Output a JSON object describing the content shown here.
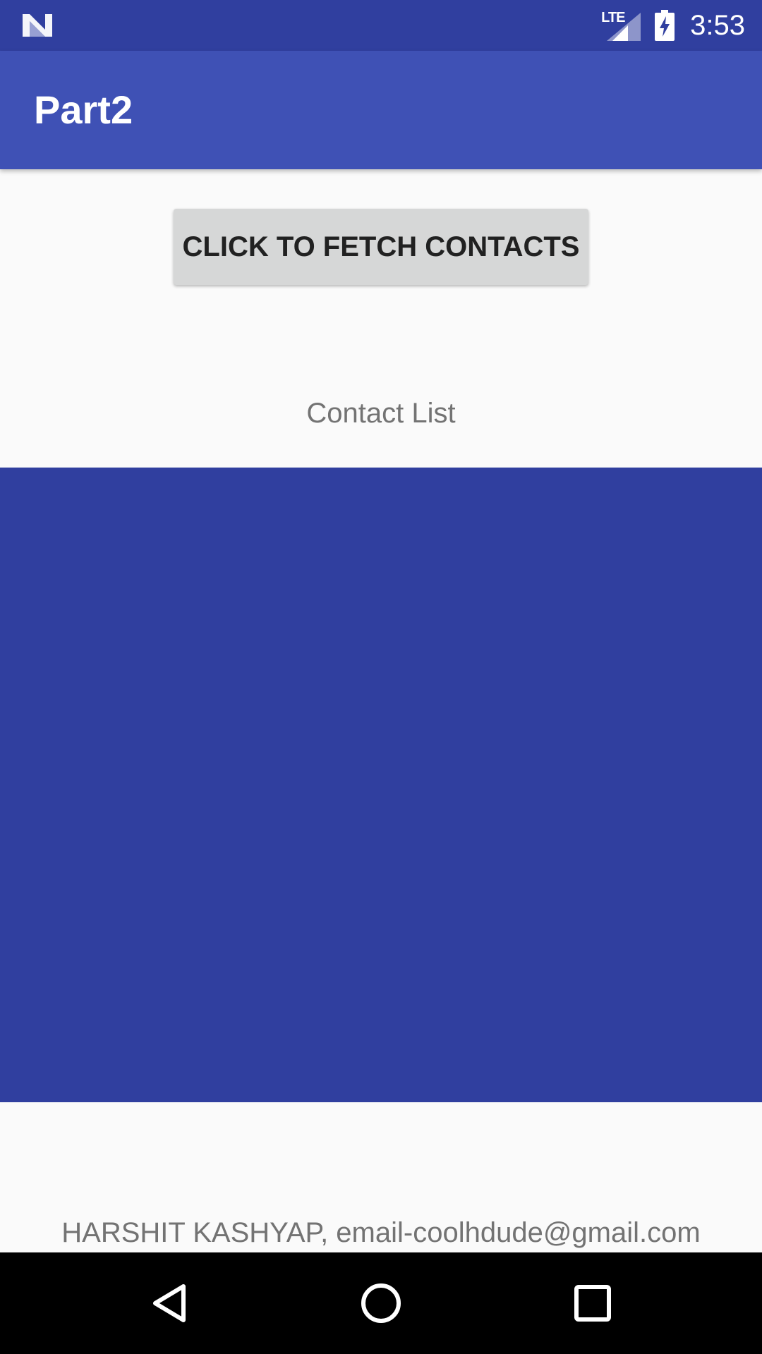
{
  "status_bar": {
    "left_icon": "n-notification-icon",
    "network_label": "LTE",
    "signal_icon": "cell-signal-icon",
    "battery_icon": "battery-charging-icon",
    "time": "3:53"
  },
  "app_bar": {
    "title": "Part2"
  },
  "main": {
    "fetch_button_label": "CLICK TO FETCH CONTACTS",
    "contact_list_label": "Contact List",
    "footer": "HARSHIT KASHYAP, email-coolhdude@gmail.com"
  },
  "nav_bar": {
    "back_icon": "back-triangle-icon",
    "home_icon": "home-circle-icon",
    "recents_icon": "recents-square-icon"
  },
  "colors": {
    "status_bar": "#303f9f",
    "app_bar": "#3f51b5",
    "contacts_panel": "#303f9f",
    "background": "#fafafa",
    "button": "#d6d7d7",
    "secondary_text": "#737373"
  }
}
